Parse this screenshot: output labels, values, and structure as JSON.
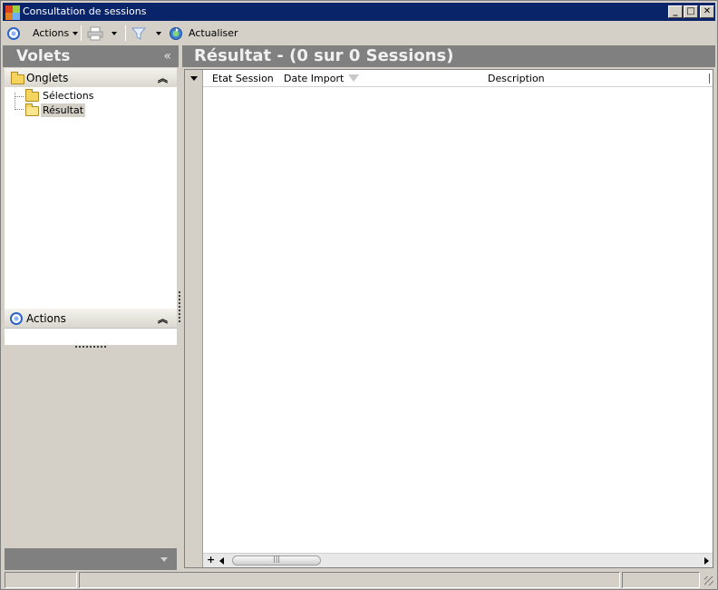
{
  "window": {
    "title": "Consultation de sessions",
    "minimize": "_",
    "maximize": "□",
    "close": "✕"
  },
  "toolbar": {
    "actions_label": "Actions",
    "refresh_label": "Actualiser"
  },
  "left_pane": {
    "title": "Volets",
    "collapse_glyph": "«",
    "tabs_group": {
      "label": "Onglets",
      "chevron": "︽",
      "items": [
        {
          "label": "Sélections",
          "selected": false
        },
        {
          "label": "Résultat",
          "selected": true
        }
      ]
    },
    "actions_group": {
      "label": "Actions",
      "chevron": "︽"
    }
  },
  "result": {
    "title": "Résultat - (0 sur 0 Sessions)",
    "columns": [
      {
        "label": "Etat Session"
      },
      {
        "label": "Date Import",
        "filter_icon": true
      },
      {
        "label": "Description"
      }
    ],
    "rows": [],
    "add_glyph": "+",
    "thumb_glyph": "|||"
  },
  "statusbar": {
    "cells": [
      "",
      "",
      ""
    ]
  },
  "colors": {
    "titlebar": "#0a246a",
    "pane_header": "#808080",
    "accent": "#2c63c8",
    "folder": "#f5d45e"
  }
}
